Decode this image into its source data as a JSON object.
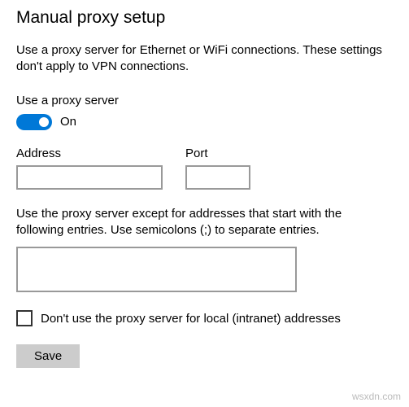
{
  "header": {
    "title": "Manual proxy setup"
  },
  "description": "Use a proxy server for Ethernet or WiFi connections. These settings don't apply to VPN connections.",
  "toggle": {
    "label": "Use a proxy server",
    "state_text": "On",
    "on": true
  },
  "fields": {
    "address": {
      "label": "Address",
      "value": ""
    },
    "port": {
      "label": "Port",
      "value": ""
    }
  },
  "exceptions": {
    "description": "Use the proxy server except for addresses that start with the following entries. Use semicolons (;) to separate entries.",
    "value": ""
  },
  "local_bypass": {
    "label": "Don't use the proxy server for local (intranet) addresses",
    "checked": false
  },
  "buttons": {
    "save": "Save"
  },
  "watermark": "wsxdn.com"
}
